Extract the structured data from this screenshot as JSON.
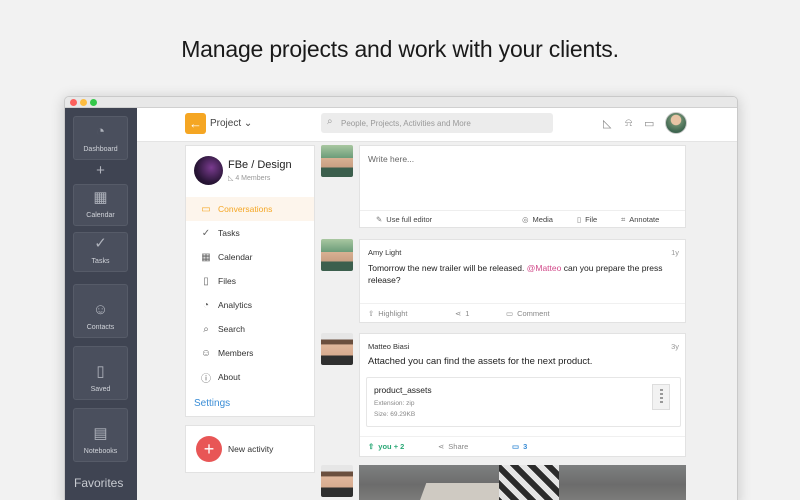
{
  "headline": "Manage projects and work with your clients.",
  "dock": {
    "items": [
      {
        "label": "Dashboard",
        "icon": "gauge-icon"
      },
      {
        "label": "Calendar",
        "icon": "calendar-icon"
      },
      {
        "label": "Tasks",
        "icon": "check-circle-icon"
      },
      {
        "label": "Contacts",
        "icon": "contacts-icon"
      },
      {
        "label": "Saved",
        "icon": "bookmark-icon"
      },
      {
        "label": "Notebooks",
        "icon": "notebook-icon"
      }
    ],
    "favorites": "Favorites"
  },
  "topbar": {
    "project_label": "Project",
    "search_placeholder": "People, Projects, Activities and More"
  },
  "project": {
    "name": "FBe / Design",
    "members": "4 Members",
    "nav": [
      {
        "label": "Conversations",
        "icon": "chat-icon",
        "active": true
      },
      {
        "label": "Tasks",
        "icon": "check-circle-icon",
        "active": false
      },
      {
        "label": "Calendar",
        "icon": "calendar-icon",
        "active": false
      },
      {
        "label": "Files",
        "icon": "file-icon",
        "active": false
      },
      {
        "label": "Analytics",
        "icon": "pie-chart-icon",
        "active": false
      },
      {
        "label": "Search",
        "icon": "search-icon",
        "active": false
      },
      {
        "label": "Members",
        "icon": "members-icon",
        "active": false
      },
      {
        "label": "About",
        "icon": "info-icon",
        "active": false
      }
    ],
    "settings": "Settings"
  },
  "new_activity": "New activity",
  "compose": {
    "placeholder": "Write here...",
    "full_editor": "Use full editor",
    "media": "Media",
    "file": "File",
    "annotate": "Annotate"
  },
  "posts": [
    {
      "author": "Amy Light",
      "time": "1y",
      "text_before": "Tomorrow the new trailer will be released. ",
      "mention": "@Matteo",
      "text_after": " can you prepare the press release?",
      "highlight": "Highlight",
      "shares": "1",
      "comment": "Comment"
    },
    {
      "author": "Matteo Biasi",
      "time": "3y",
      "text": "Attached you can find the assets for the next product.",
      "attachment": {
        "name": "product_assets",
        "extension": "Extension: zip",
        "size": "Size: 69.29KB"
      },
      "highlight": "you + 2",
      "share": "Share",
      "comments": "3"
    }
  ],
  "colors": {
    "accent_orange": "#f5a623",
    "link_blue": "#3a8dd6",
    "mention_pink": "#d24a8a",
    "new_activity_red": "#e85656",
    "dock_bg": "#3f4452",
    "highlight_green": "#2aa876"
  }
}
